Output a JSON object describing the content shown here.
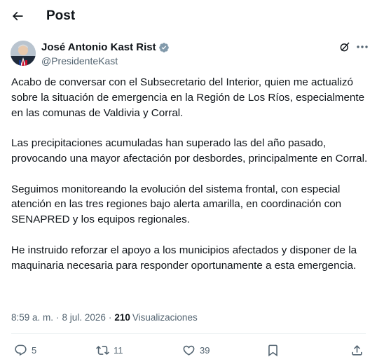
{
  "header": {
    "title": "Post"
  },
  "author": {
    "display_name": "José Antonio Kast Rist",
    "handle": "@PresidenteKast"
  },
  "tweet": {
    "paragraphs": [
      "Acabo de conversar con el Subsecretario del Interior, quien me actualizó sobre la situación de emergencia en la Región de Los Ríos, especialmente en las comunas de Valdivia y Corral.",
      "Las precipitaciones acumuladas han superado las del año pasado, provocando una mayor afectación por desbordes, principalmente en Corral.",
      "Seguimos monitoreando la evolución del sistema frontal, con especial atención en las tres regiones bajo alerta amarilla, en coordinación con SENAPRED y los equipos regionales.",
      "He instruido reforzar el apoyo a los municipios afectados y disponer de la maquinaria necesaria para responder oportunamente a esta emergencia."
    ]
  },
  "meta": {
    "time": "8:59 a. m.",
    "separator": "·",
    "date": "8 jul. 2026",
    "views_count": "210",
    "views_label": "Visualizaciones"
  },
  "actions": {
    "replies": "5",
    "reposts": "11",
    "likes": "39"
  },
  "colors": {
    "text_primary": "#0f1419",
    "text_secondary": "#536471",
    "verified_blue": "#1d9bf0",
    "divider": "#eff3f4"
  }
}
